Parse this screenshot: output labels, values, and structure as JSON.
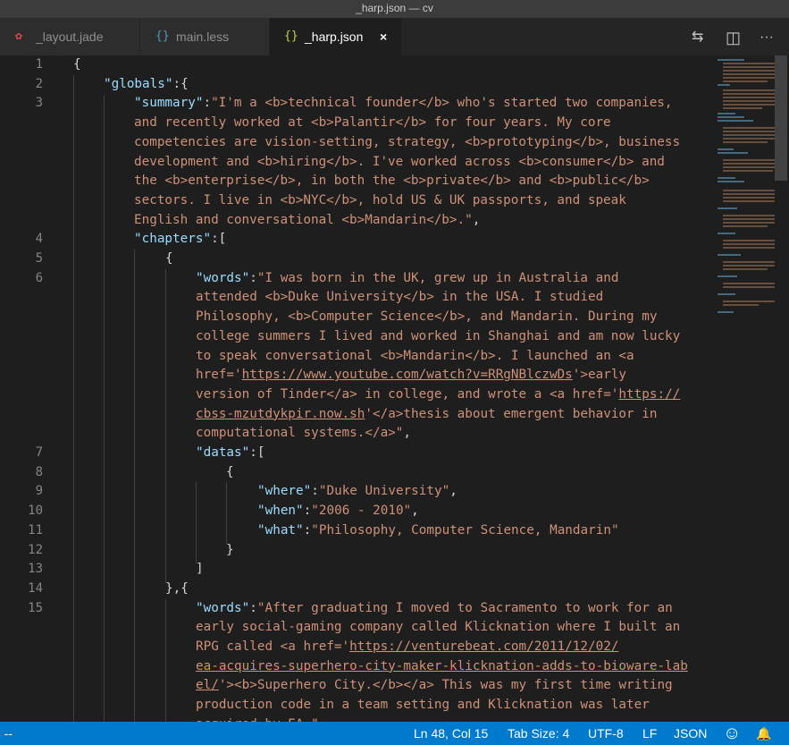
{
  "window": {
    "title": "_harp.json — cv"
  },
  "tabs": [
    {
      "label": "_layout.jade",
      "icon": "jade-icon"
    },
    {
      "label": "main.less",
      "icon": "less-icon"
    },
    {
      "label": "_harp.json",
      "icon": "json-icon",
      "close": "×"
    }
  ],
  "toolbar": {
    "compare_icon": "⇆",
    "split_icon": "◫",
    "more_icon": "···"
  },
  "gutter": {
    "line_numbers": [
      "1",
      "2",
      "3",
      "",
      "",
      "",
      "",
      "",
      "",
      "4",
      "5",
      "6",
      "",
      "",
      "",
      "",
      "",
      "",
      "",
      "",
      "7",
      "8",
      "9",
      "10",
      "11",
      "12",
      "13",
      "14",
      "15"
    ]
  },
  "code": [
    [
      "{"
    ],
    [
      "\"globals\"",
      ":{"
    ],
    [
      "\"summary\"",
      ":",
      "\"I'm a <b>technical founder</b> who's started two companies,"
    ],
    [
      "and recently worked at <b>Palantir</b> for four years. My core"
    ],
    [
      "competencies are vision-setting, strategy, <b>prototyping</b>, business"
    ],
    [
      "development and <b>hiring</b>. I've worked across <b>consumer</b> and"
    ],
    [
      "the <b>enterprise</b>, in both the <b>private</b> and <b>public</b>"
    ],
    [
      "sectors. I live in <b>NYC</b>, hold US & UK passports, and speak"
    ],
    [
      "English and conversational <b>Mandarin</b>.\"",
      ","
    ],
    [
      "\"chapters\"",
      ":["
    ],
    [
      "{"
    ],
    [
      "\"words\"",
      ":",
      "\"I was born in the UK, grew up in Australia and"
    ],
    [
      "attended <b>Duke University</b> in the USA. I studied"
    ],
    [
      "Philosophy, <b>Computer Science</b>, and Mandarin. During my"
    ],
    [
      "college summers I lived and worked in Shanghai and am now lucky"
    ],
    [
      "to speak conversational <b>Mandarin</b>. I launched an <a"
    ],
    [
      "href='",
      "https://www.youtube.com/watch?v=RRgNBlczwDs",
      "'>early"
    ],
    [
      "version of Tinder</a> in college, and wrote a <a href='",
      "https://"
    ],
    [
      "cbss-mzutdykpir.now.sh",
      "'</a>thesis about emergent behavior in"
    ],
    [
      "computational systems.</a>\"",
      ","
    ],
    [
      "\"datas\"",
      ":["
    ],
    [
      "{"
    ],
    [
      "\"where\"",
      ":",
      "\"Duke University\"",
      ","
    ],
    [
      "\"when\"",
      ":",
      "\"2006 - 2010\"",
      ","
    ],
    [
      "\"what\"",
      ":",
      "\"Philosophy, Computer Science, Mandarin\""
    ],
    [
      "}"
    ],
    [
      "]"
    ],
    [
      "},{"
    ],
    [
      "\"words\"",
      ":",
      "\"After graduating I moved to Sacramento to work for an"
    ],
    [
      "early social-gaming company called Klicknation where I built an"
    ],
    [
      "RPG called <a href='",
      "https://venturebeat.com/2011/12/02/"
    ],
    [
      "ea-acquires-superhero-city-maker-klicknation-adds-to-bioware-lab"
    ],
    [
      "el/",
      "'><b>Superhero City.</b></a> This was my first time writing"
    ],
    [
      "production code in a team setting and Klicknation was later"
    ],
    [
      "acquired by EA.\""
    ]
  ],
  "status": {
    "left": "' --",
    "position": "Ln 48, Col 15",
    "tab_size": "Tab Size: 4",
    "encoding": "UTF-8",
    "eol": "LF",
    "language": "JSON",
    "smiley": "☺",
    "bell": "🔔"
  },
  "colors": {
    "key": "#9cdcfe",
    "string": "#ce9178",
    "status_bg": "#007acc",
    "editor_bg": "#1e1e1e"
  }
}
